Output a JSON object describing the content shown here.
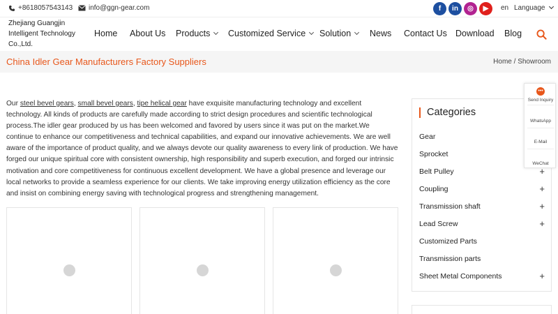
{
  "topbar": {
    "phone": "+8618057543143",
    "email": "info@ggn-gear.com",
    "social": [
      {
        "name": "facebook",
        "glyph": "f",
        "color": "#1d4fa0"
      },
      {
        "name": "linkedin",
        "glyph": "in",
        "color": "#1d4fa0"
      },
      {
        "name": "instagram",
        "glyph": "◎",
        "color": "#b22391"
      },
      {
        "name": "youtube",
        "glyph": "▶",
        "color": "#e0201c"
      }
    ],
    "lang_code": "en",
    "language_label": "Language"
  },
  "logo": {
    "line1": "Zhejiang Guangjin",
    "line2": "Intelligent Technology",
    "line3": "Co.,Ltd."
  },
  "nav": [
    {
      "label": "Home"
    },
    {
      "label": "About Us"
    },
    {
      "label": "Products"
    },
    {
      "label": "Customized Service"
    },
    {
      "label": "Solution"
    },
    {
      "label": "News"
    },
    {
      "label": "Contact Us"
    },
    {
      "label": "Download"
    },
    {
      "label": "Blog"
    }
  ],
  "page": {
    "title": "China Idler Gear Manufacturers Factory Suppliers",
    "breadcrumb_home": "Home",
    "breadcrumb_sep": " / ",
    "breadcrumb_current": "Showroom"
  },
  "intro": {
    "prefix": "Our ",
    "link1": "steel bevel gears",
    "sep1": ", ",
    "link2": "small bevel gears",
    "sep2": ", ",
    "link3": "tipe helical gear",
    "body": " have exquisite manufacturing technology and excellent technology. All kinds of products are carefully made according to strict design procedures and scientific technological process.The idler gear produced by us has been welcomed and favored by users since it was put on the market.We continue to enhance our competitiveness and technical capabilities, and expand our innovative achievements. We are well aware of the importance of product quality, and we always devote our quality awareness to every link of production. We have forged our unique spiritual core with consistent ownership, high responsibility and superb execution, and forged our intrinsic motivation and core competitiveness for continuous excellent development. We have a global presence and leverage our local networks to provide a seamless experience for our clients. We take improving energy utilization efficiency as the core and insist on combining energy saving with technological progress and strengthening management."
  },
  "sidebar": {
    "title": "Categories",
    "items": [
      {
        "label": "Gear",
        "expandable": false
      },
      {
        "label": "Sprocket",
        "expandable": false
      },
      {
        "label": "Belt Pulley",
        "expandable": true
      },
      {
        "label": "Coupling",
        "expandable": true
      },
      {
        "label": "Transmission shaft",
        "expandable": true
      },
      {
        "label": "Lead Screw",
        "expandable": true
      },
      {
        "label": "Customized Parts",
        "expandable": false
      },
      {
        "label": "Transmission parts",
        "expandable": false
      },
      {
        "label": "Sheet Metal Components",
        "expandable": true
      }
    ],
    "plus_glyph": "+"
  },
  "float_widget": {
    "inquiry": "Send Inquiry",
    "whatsapp": "WhatsApp",
    "email": "E-Mail",
    "wechat": "WeChat"
  },
  "colors": {
    "accent": "#e8571b",
    "band_bg": "#f5f5f5"
  }
}
